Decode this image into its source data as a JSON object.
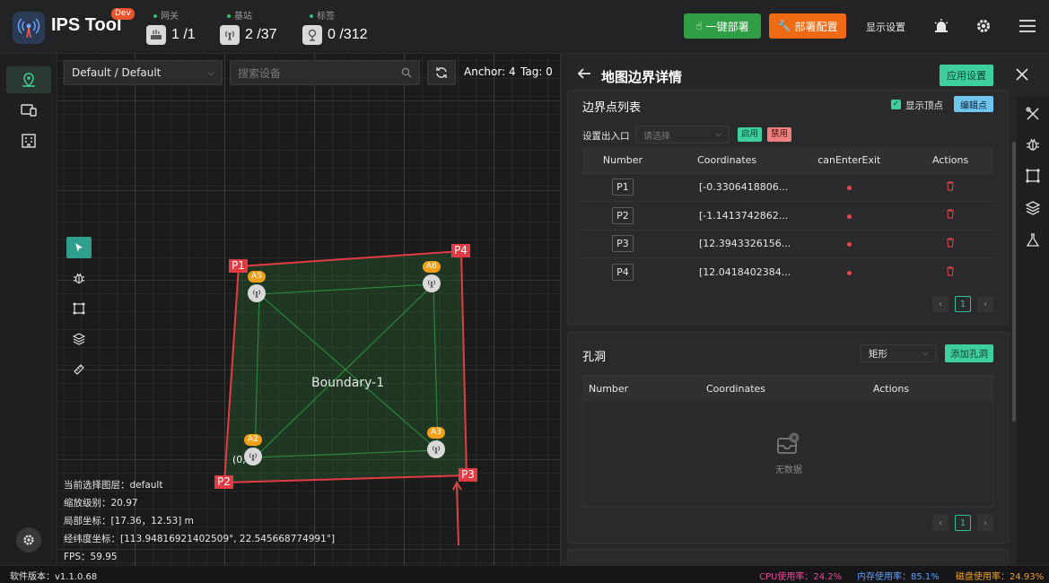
{
  "app": {
    "title": "IPS Tool",
    "badge": "Dev"
  },
  "stats": [
    {
      "label": "网关",
      "value": "1 /1",
      "icon": "gateway-icon"
    },
    {
      "label": "基站",
      "value": "2 /37",
      "icon": "anchor-icon"
    },
    {
      "label": "标签",
      "value": "0 /312",
      "icon": "tag-icon"
    }
  ],
  "header": {
    "deploy_label": "一键部署",
    "config_label": "部署配置",
    "display_label": "显示设置",
    "colors": {
      "green": "#2f9e44",
      "orange": "#f06a14"
    }
  },
  "map": {
    "layer_select": "Default / Default",
    "search_placeholder": "搜索设备",
    "anchor_count": "Anchor: 4",
    "tag_count": "Tag: 0",
    "boundary_label": "Boundary-1",
    "boundary_points": [
      "P1",
      "P2",
      "P3",
      "P4"
    ],
    "anchors": [
      "A5",
      "A6",
      "A2",
      "A3"
    ],
    "origin_label": "(0,",
    "info": {
      "layer": "当前选择图层：default",
      "zoom": "缩放级别：20.97",
      "local": "局部坐标：[17.36，12.53] m",
      "latlng": "经纬度坐标：[113.94816921402509°, 22.545668774991°]",
      "fps": "FPS：59.95"
    }
  },
  "panel": {
    "title": "地图边界详情",
    "apply_label": "应用设置",
    "boundary_section": {
      "title": "边界点列表",
      "show_vertex_label": "显示顶点",
      "edit_label": "编辑点",
      "exit_label": "设置出入口",
      "exit_placeholder": "请选择",
      "enable_label": "启用",
      "disable_label": "禁用",
      "columns": [
        "Number",
        "Coordinates",
        "canEnterExit",
        "Actions"
      ],
      "rows": [
        {
          "number": "P1",
          "coords": "[-0.3306418806..."
        },
        {
          "number": "P2",
          "coords": "[-1.1413742862..."
        },
        {
          "number": "P3",
          "coords": "[12.3943326156..."
        },
        {
          "number": "P4",
          "coords": "[12.0418402384..."
        }
      ],
      "page": "1"
    },
    "hole_section": {
      "title": "孔洞",
      "shape_select": "矩形",
      "add_label": "添加孔洞",
      "columns": [
        "Number",
        "Coordinates",
        "Actions"
      ],
      "empty_text": "无数据",
      "page": "1"
    }
  },
  "status": {
    "version": "软件版本：v1.1.0.68",
    "cpu": "CPU使用率：24.2%",
    "mem": "内存使用率：85.1%",
    "disk": "磁盘使用率：24.93%"
  }
}
